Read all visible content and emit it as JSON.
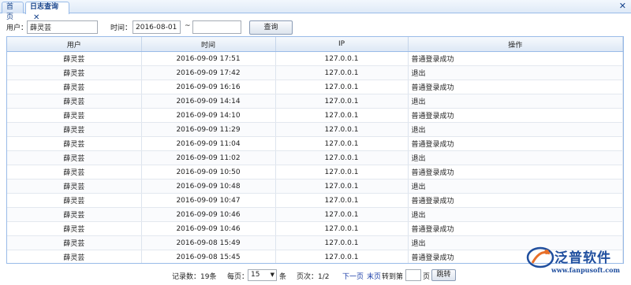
{
  "tabs": [
    {
      "label": "首页",
      "active": false
    },
    {
      "label": "日志查询",
      "active": true
    }
  ],
  "window": {
    "close_icon": "close-icon"
  },
  "search": {
    "user_label": "用户：",
    "user_value": "薛灵芸",
    "time_label": "时间：",
    "date_from": "2016-08-01",
    "range_sep": "~",
    "date_to": "",
    "query_label": "查询"
  },
  "table": {
    "columns": [
      "用户",
      "时间",
      "IP",
      "操作"
    ],
    "rows": [
      [
        "薛灵芸",
        "2016-09-09 17:51",
        "127.0.0.1",
        "普通登录成功"
      ],
      [
        "薛灵芸",
        "2016-09-09 17:42",
        "127.0.0.1",
        "退出"
      ],
      [
        "薛灵芸",
        "2016-09-09 16:16",
        "127.0.0.1",
        "普通登录成功"
      ],
      [
        "薛灵芸",
        "2016-09-09 14:14",
        "127.0.0.1",
        "退出"
      ],
      [
        "薛灵芸",
        "2016-09-09 14:10",
        "127.0.0.1",
        "普通登录成功"
      ],
      [
        "薛灵芸",
        "2016-09-09 11:29",
        "127.0.0.1",
        "退出"
      ],
      [
        "薛灵芸",
        "2016-09-09 11:04",
        "127.0.0.1",
        "普通登录成功"
      ],
      [
        "薛灵芸",
        "2016-09-09 11:02",
        "127.0.0.1",
        "退出"
      ],
      [
        "薛灵芸",
        "2016-09-09 10:50",
        "127.0.0.1",
        "普通登录成功"
      ],
      [
        "薛灵芸",
        "2016-09-09 10:48",
        "127.0.0.1",
        "退出"
      ],
      [
        "薛灵芸",
        "2016-09-09 10:47",
        "127.0.0.1",
        "普通登录成功"
      ],
      [
        "薛灵芸",
        "2016-09-09 10:46",
        "127.0.0.1",
        "退出"
      ],
      [
        "薛灵芸",
        "2016-09-09 10:46",
        "127.0.0.1",
        "普通登录成功"
      ],
      [
        "薛灵芸",
        "2016-09-08 15:49",
        "127.0.0.1",
        "退出"
      ],
      [
        "薛灵芸",
        "2016-09-08 15:45",
        "127.0.0.1",
        "普通登录成功"
      ]
    ]
  },
  "pager": {
    "records_label": "记录数：19条",
    "per_page_label": "每页：",
    "per_page_value": "15",
    "per_page_unit": "条",
    "page_label": "页次：1/2",
    "next_label": "下一页",
    "last_label": "末页",
    "goto_label": "转到第",
    "goto_unit": "页",
    "jump_label": "跳转"
  },
  "logo": {
    "brand": "泛普软件",
    "url": "www.fanpusoft.com",
    "icon": "fanpu-logo-icon",
    "colors": {
      "primary": "#1f4e9e",
      "accent": "#e8702a"
    }
  }
}
